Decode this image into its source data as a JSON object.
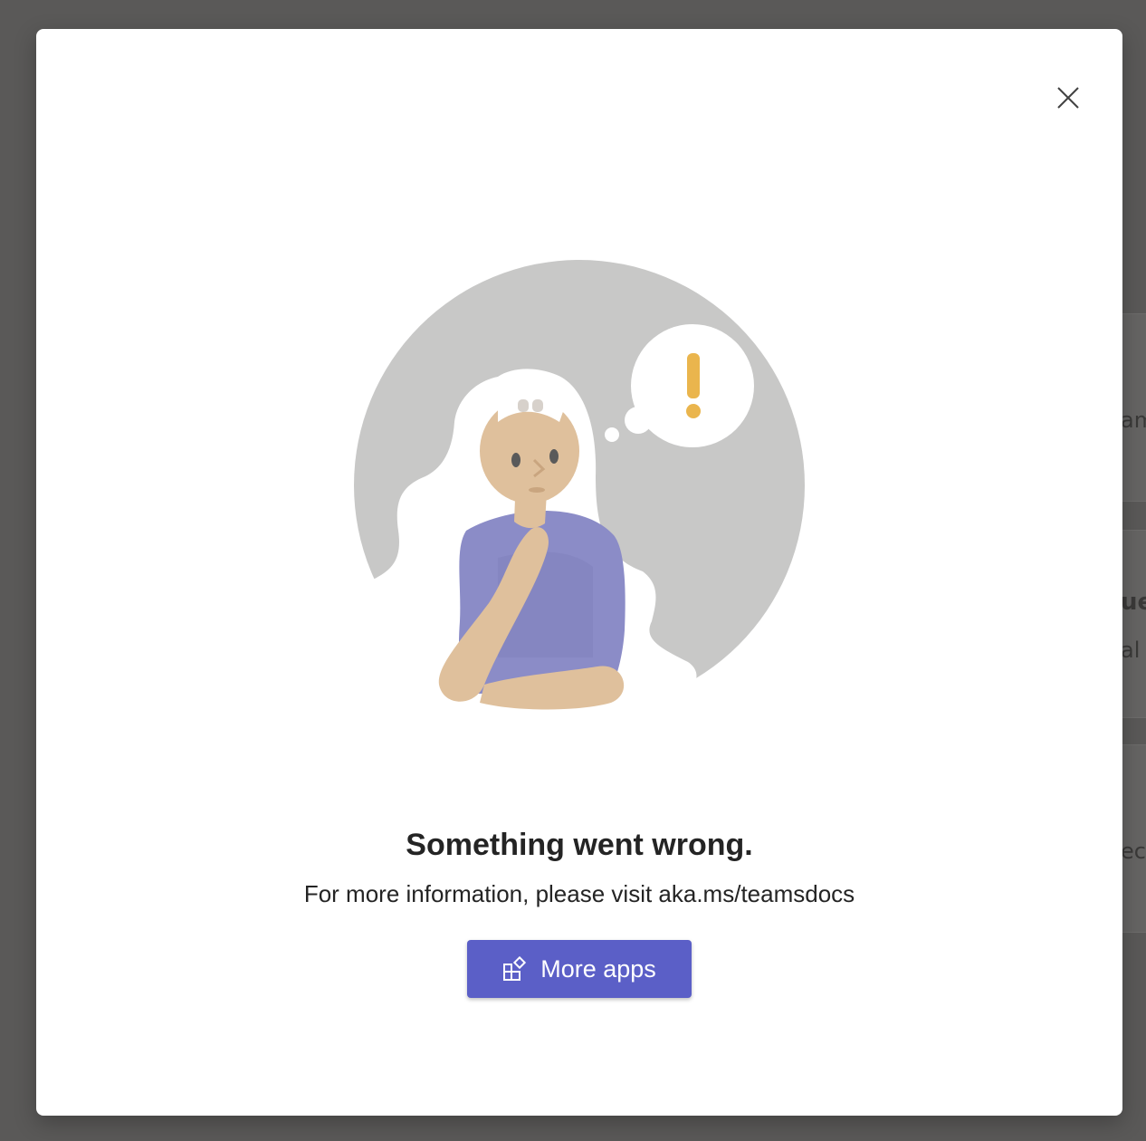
{
  "dialog": {
    "title": "Something went wrong.",
    "message": "For more information, please visit aka.ms/teamsdocs",
    "primary_button_label": "More apps",
    "primary_button_icon": "apps-add-icon",
    "close_icon": "close-icon"
  },
  "background": {
    "fragments": [
      "am",
      "ue",
      "al",
      "eck"
    ]
  },
  "colors": {
    "overlay": "#5a5958",
    "dialog_bg": "#ffffff",
    "button_bg": "#5b5fc7",
    "button_text": "#ffffff",
    "text": "#242424",
    "illustration_circle": "#c8c8c7",
    "shirt": "#8b8cc7",
    "skin": "#dfc09c",
    "exclamation": "#eab54d"
  }
}
